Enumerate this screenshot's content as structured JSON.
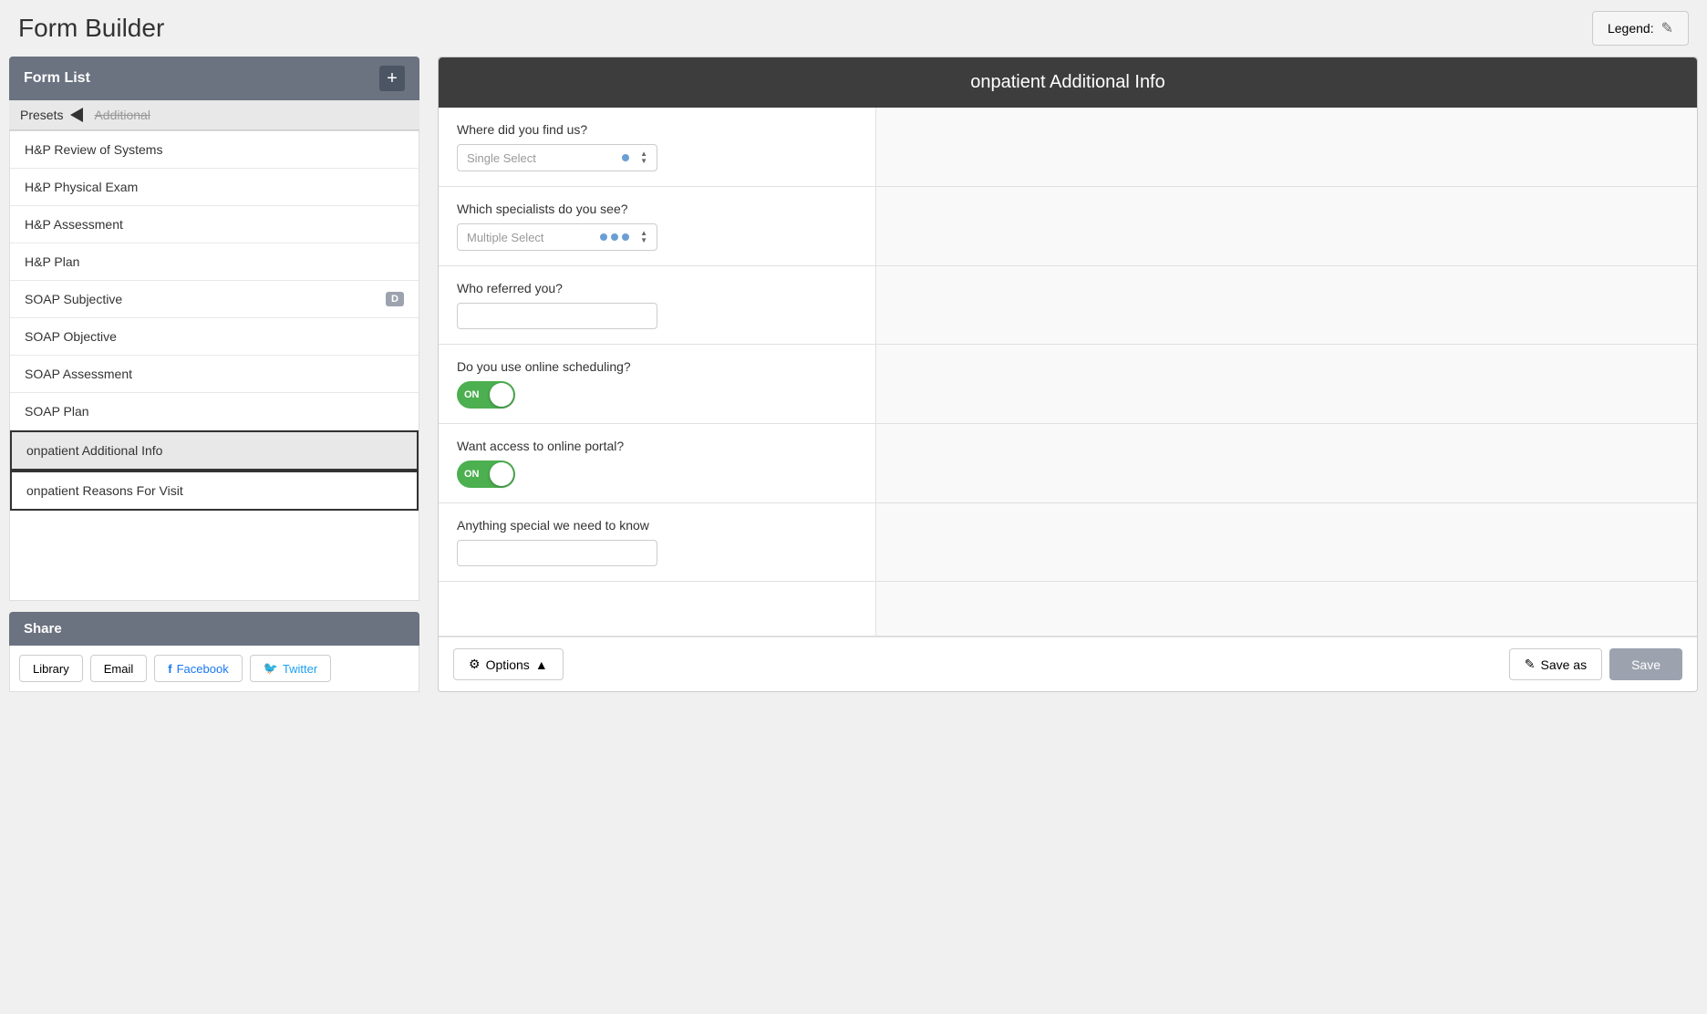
{
  "header": {
    "title": "Form Builder",
    "legend_label": "Legend:",
    "edit_icon": "✎"
  },
  "sidebar": {
    "title": "Form List",
    "add_icon": "+",
    "presets_label": "Presets",
    "presets_strikethrough": "Additional",
    "form_items": [
      {
        "id": "hp-review",
        "label": "H&P Review of Systems",
        "active": false,
        "draft": false
      },
      {
        "id": "hp-physical",
        "label": "H&P Physical Exam",
        "active": false,
        "draft": false
      },
      {
        "id": "hp-assessment",
        "label": "H&P Assessment",
        "active": false,
        "draft": false
      },
      {
        "id": "hp-plan",
        "label": "H&P Plan",
        "active": false,
        "draft": false
      },
      {
        "id": "soap-subjective",
        "label": "SOAP Subjective",
        "active": false,
        "draft": true,
        "draft_label": "D"
      },
      {
        "id": "soap-objective",
        "label": "SOAP Objective",
        "active": false,
        "draft": false
      },
      {
        "id": "soap-assessment",
        "label": "SOAP Assessment",
        "active": false,
        "draft": false
      },
      {
        "id": "soap-plan",
        "label": "SOAP Plan",
        "active": false,
        "draft": false
      },
      {
        "id": "onpatient-additional",
        "label": "onpatient Additional Info",
        "active": true,
        "draft": false
      },
      {
        "id": "onpatient-reasons",
        "label": "onpatient Reasons For Visit",
        "active": false,
        "selected": true,
        "draft": false
      }
    ]
  },
  "share": {
    "title": "Share",
    "buttons": [
      {
        "id": "library",
        "label": "Library"
      },
      {
        "id": "email",
        "label": "Email"
      },
      {
        "id": "facebook",
        "label": "Facebook",
        "icon": "f"
      },
      {
        "id": "twitter",
        "label": "Twitter",
        "icon": "🐦"
      }
    ]
  },
  "form": {
    "title": "onpatient Additional Info",
    "fields": [
      {
        "id": "where-find-us",
        "label": "Where did you find us?",
        "type": "single-select",
        "placeholder": "Single Select",
        "dots": 1
      },
      {
        "id": "which-specialists",
        "label": "Which specialists do you see?",
        "type": "multiple-select",
        "placeholder": "Multiple Select",
        "dots": 3
      },
      {
        "id": "who-referred",
        "label": "Who referred you?",
        "type": "text-input",
        "placeholder": ""
      },
      {
        "id": "online-scheduling",
        "label": "Do you use online scheduling?",
        "type": "toggle",
        "value": "ON",
        "enabled": true
      },
      {
        "id": "online-portal",
        "label": "Want access to online portal?",
        "type": "toggle",
        "value": "ON",
        "enabled": true
      },
      {
        "id": "special-notes",
        "label": "Anything special we need to know",
        "type": "text-input",
        "placeholder": ""
      }
    ],
    "footer": {
      "options_label": "Options",
      "options_icon": "⚙",
      "options_arrow": "▲",
      "save_as_label": "Save as",
      "save_as_icon": "✎",
      "save_label": "Save"
    }
  }
}
